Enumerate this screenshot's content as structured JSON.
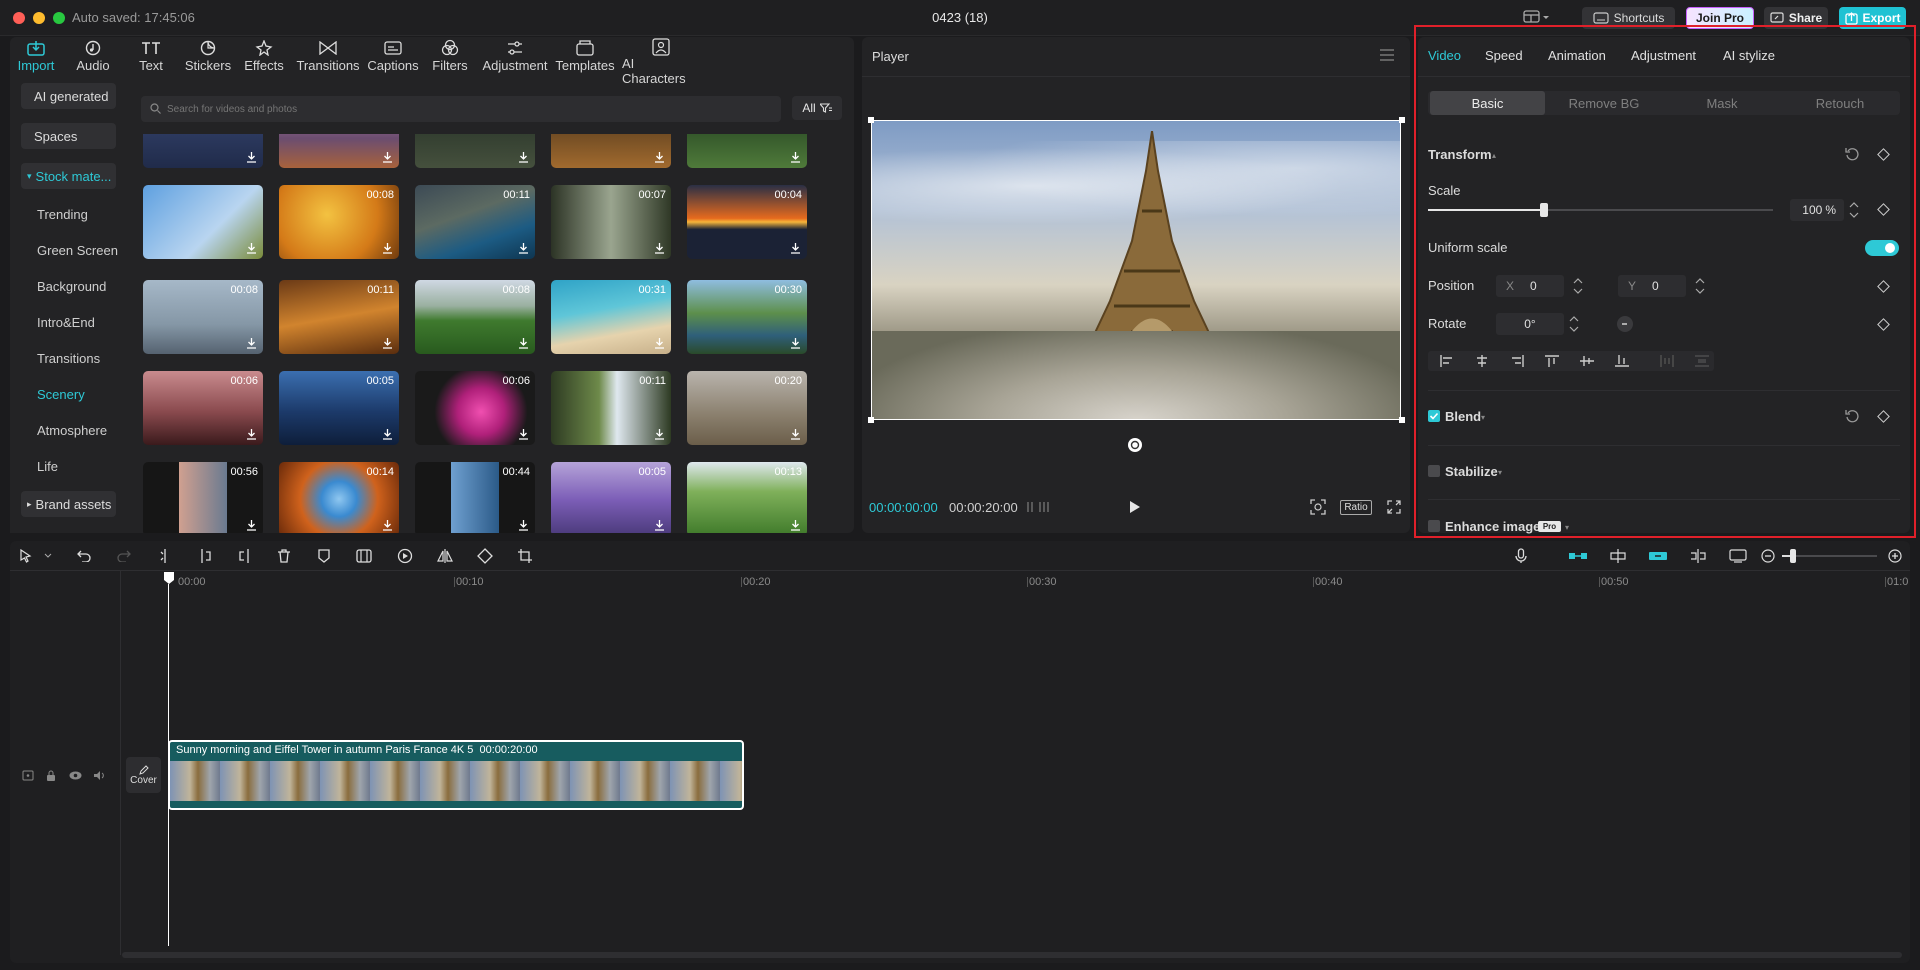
{
  "titlebar": {
    "autosave": "Auto saved: 17:45:06",
    "project_title": "0423 (18)",
    "shortcuts_label": "Shortcuts",
    "join_pro_label": "Join Pro",
    "share_label": "Share",
    "export_label": "Export"
  },
  "toolbar": {
    "tabs": [
      {
        "label": "Import",
        "icon": "import-icon"
      },
      {
        "label": "Audio",
        "icon": "audio-icon"
      },
      {
        "label": "Text",
        "icon": "text-icon"
      },
      {
        "label": "Stickers",
        "icon": "stickers-icon"
      },
      {
        "label": "Effects",
        "icon": "effects-icon"
      },
      {
        "label": "Transitions",
        "icon": "transitions-icon"
      },
      {
        "label": "Captions",
        "icon": "captions-icon"
      },
      {
        "label": "Filters",
        "icon": "filters-icon"
      },
      {
        "label": "Adjustment",
        "icon": "adjustment-icon"
      },
      {
        "label": "Templates",
        "icon": "templates-icon"
      },
      {
        "label": "AI Characters",
        "icon": "ai-characters-icon"
      }
    ]
  },
  "sidebar": {
    "ai_generated": "AI generated",
    "spaces": "Spaces",
    "stock_material": "Stock mate...",
    "items": [
      "Trending",
      "Green Screen",
      "Background",
      "Intro&End",
      "Transitions",
      "Scenery",
      "Atmosphere",
      "Life"
    ],
    "brand_assets": "Brand assets"
  },
  "media": {
    "search_placeholder": "Search for videos and photos",
    "filter_label": "All",
    "durations": [
      "",
      "",
      "",
      "",
      "",
      "",
      "00:08",
      "00:11",
      "00:07",
      "00:04",
      "00:08",
      "00:11",
      "00:08",
      "00:31",
      "00:30",
      "00:06",
      "00:05",
      "00:06",
      "00:11",
      "00:20",
      "00:56",
      "00:14",
      "00:44",
      "00:05",
      "00:13"
    ]
  },
  "player": {
    "title": "Player",
    "current_time": "00:00:00:00",
    "total_time": "00:00:20:00",
    "ratio_label": "Ratio"
  },
  "inspector": {
    "tabs": [
      "Video",
      "Speed",
      "Animation",
      "Adjustment",
      "AI stylize"
    ],
    "subtabs": [
      "Basic",
      "Remove BG",
      "Mask",
      "Retouch"
    ],
    "transform_label": "Transform",
    "scale_label": "Scale",
    "scale_value": "100",
    "scale_unit": "%",
    "scale_level": 1.0,
    "uniform_scale_label": "Uniform scale",
    "uniform_scale_on": true,
    "position_label": "Position",
    "position_x_label": "X",
    "position_x": "0",
    "position_y_label": "Y",
    "position_y": "0",
    "rotate_label": "Rotate",
    "rotate_value": "0°",
    "blend_label": "Blend",
    "blend_checked": true,
    "stabilize_label": "Stabilize",
    "enhance_label": "Enhance image",
    "pro_badge": "Pro"
  },
  "timeline": {
    "ruler": [
      "00:00",
      "00:10",
      "00:20",
      "00:30",
      "00:40",
      "00:50",
      "01:0"
    ],
    "clip_title": "Sunny morning and Eiffel Tower in autumn Paris France 4K 5",
    "clip_duration": "00:00:20:00",
    "cover_label": "Cover"
  },
  "colors": {
    "accent": "#2ec9d6",
    "clip_bg": "#175c5f",
    "highlight_border": "#e0202a"
  }
}
